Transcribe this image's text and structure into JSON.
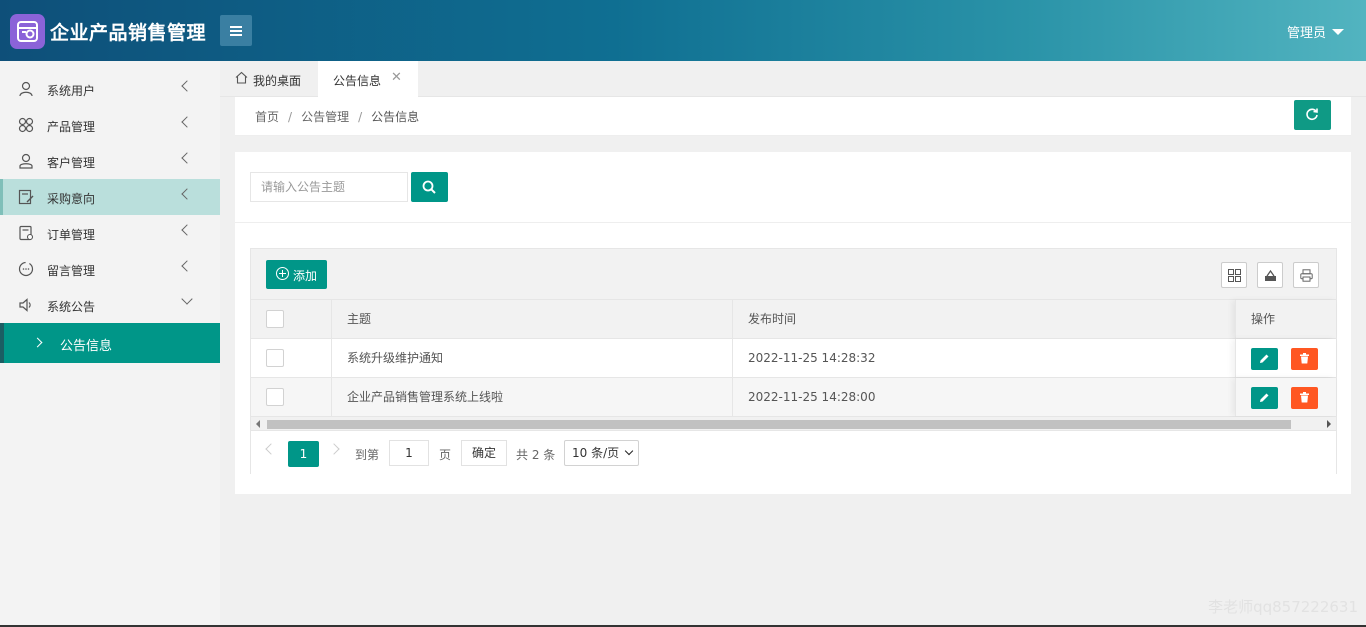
{
  "header": {
    "app_title": "企业产品销售管理",
    "user_label": "管理员"
  },
  "sidebar": {
    "items": [
      {
        "label": "系统用户",
        "icon": "user-icon"
      },
      {
        "label": "产品管理",
        "icon": "flower-icon"
      },
      {
        "label": "客户管理",
        "icon": "person-icon"
      },
      {
        "label": "采购意向",
        "icon": "edit-doc-icon"
      },
      {
        "label": "订单管理",
        "icon": "order-icon"
      },
      {
        "label": "留言管理",
        "icon": "message-icon"
      },
      {
        "label": "系统公告",
        "icon": "speaker-icon"
      }
    ],
    "sub_active": "公告信息"
  },
  "tabs": [
    {
      "label": "我的桌面"
    },
    {
      "label": "公告信息",
      "close": "✕"
    }
  ],
  "breadcrumb": {
    "home": "首页",
    "parent": "公告管理",
    "current": "公告信息",
    "separator": "/"
  },
  "search": {
    "placeholder": "请输入公告主题"
  },
  "toolbar": {
    "add_label": "添加"
  },
  "table": {
    "columns": [
      "主题",
      "发布时间",
      "操作"
    ],
    "rows": [
      {
        "title": "系统升级维护通知",
        "time": "2022-11-25 14:28:32"
      },
      {
        "title": "企业产品销售管理系统上线啦",
        "time": "2022-11-25 14:28:00"
      }
    ]
  },
  "pagination": {
    "current_page": "1",
    "goto_label": "到第",
    "goto_value": "1",
    "page_unit": "页",
    "confirm_label": "确定",
    "total_label": "共 2 条",
    "page_size": "10 条/页"
  },
  "watermark": "李老师qq857222631",
  "colors": {
    "primary": "#009688",
    "danger": "#ff5722",
    "logo": "#8b63d8"
  }
}
